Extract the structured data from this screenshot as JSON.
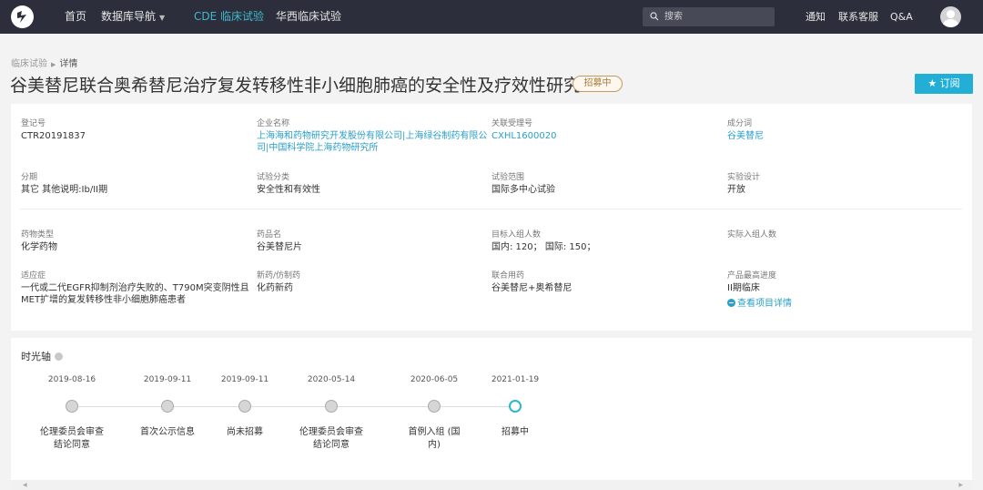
{
  "nav": {
    "home": "首页",
    "db_nav": "数据库导航",
    "cde": "CDE 临床试验",
    "huaxi": "华西临床试验",
    "search_placeholder": "搜索",
    "notice": "通知",
    "service": "联系客服",
    "qa": "Q&A"
  },
  "breadcrumb": {
    "parent": "临床试验",
    "current": "详情"
  },
  "title": "谷美替尼联合奥希替尼治疗复发转移性非小细胞肺癌的安全性及疗效性研究",
  "status": "招募中",
  "subscribe": "订阅",
  "info": {
    "reg_no": {
      "label": "登记号",
      "value": "CTR20191837"
    },
    "company": {
      "label": "企业名称",
      "line1": "上海海和药物研究开发股份有限公司|上海绿谷制药有限公",
      "line2": "司|中国科学院上海药物研究所"
    },
    "accept_no": {
      "label": "关联受理号",
      "value": "CXHL1600020"
    },
    "ingredient": {
      "label": "成分词",
      "value": "谷美替尼"
    },
    "phase": {
      "label": "分期",
      "value": "其它 其他说明:Ib/II期"
    },
    "category": {
      "label": "试验分类",
      "value": "安全性和有效性"
    },
    "scope": {
      "label": "试验范围",
      "value": "国际多中心试验"
    },
    "design": {
      "label": "实验设计",
      "value": "开放"
    },
    "drug_type": {
      "label": "药物类型",
      "value": "化学药物"
    },
    "drug_name": {
      "label": "药品名",
      "value": "谷美替尼片"
    },
    "target": {
      "label": "目标入组人数",
      "value": "国内: 120； 国际: 150；"
    },
    "actual": {
      "label": "实际入组人数",
      "value": ""
    },
    "indication": {
      "label": "适应症",
      "line1": "一代或二代EGFR抑制剂治疗失败的、T790M突变阴性且",
      "line2": "MET扩增的复发转移性非小细胞肺癌患者"
    },
    "new_drug": {
      "label": "新药/仿制药",
      "value": "化药新药"
    },
    "combo": {
      "label": "联合用药",
      "value": "谷美替尼+奥希替尼"
    },
    "progress": {
      "label": "产品最高进度",
      "value": "II期临床",
      "link": "查看项目详情"
    }
  },
  "timeline": {
    "title": "时光轴",
    "events": [
      {
        "date": "2019-08-16",
        "line1": "伦理委员会审查",
        "line2": "结论同意"
      },
      {
        "date": "2019-09-11",
        "line1": "首次公示信息",
        "line2": ""
      },
      {
        "date": "2019-09-11",
        "line1": "尚未招募",
        "line2": ""
      },
      {
        "date": "2020-05-14",
        "line1": "伦理委员会审查",
        "line2": "结论同意"
      },
      {
        "date": "2020-06-05",
        "line1": "首例入组 (国",
        "line2": "内)"
      },
      {
        "date": "2021-01-19",
        "line1": "招募中",
        "line2": ""
      }
    ]
  },
  "colors": {
    "accent": "#23aed6",
    "link": "#2a9fc9",
    "status_border": "#c29a61",
    "topbar": "#2c2f3b"
  }
}
